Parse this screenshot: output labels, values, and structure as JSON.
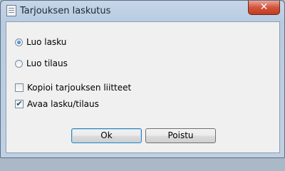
{
  "window": {
    "title": "Tarjouksen laskutus",
    "close_glyph": "✕"
  },
  "options": {
    "radio_create_invoice": {
      "label": "Luo lasku",
      "selected": true
    },
    "radio_create_order": {
      "label": "Luo tilaus",
      "selected": false
    },
    "check_copy_attachments": {
      "label": "Kopioi tarjouksen liitteet",
      "checked": false
    },
    "check_open_invoice_order": {
      "label": "Avaa lasku/tilaus",
      "checked": true
    }
  },
  "buttons": {
    "ok": "Ok",
    "exit": "Poistu"
  }
}
